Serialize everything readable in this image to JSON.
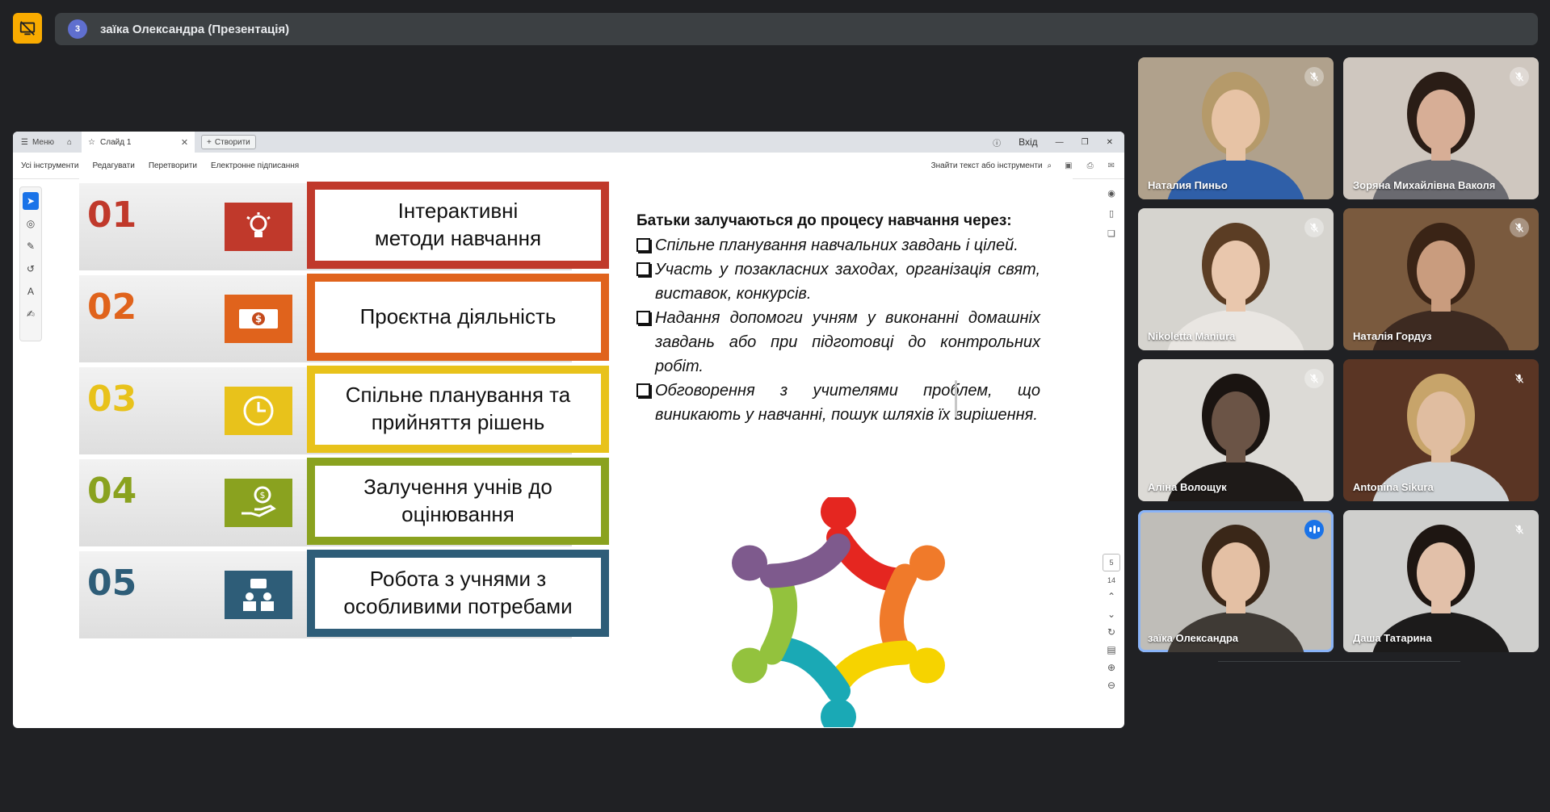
{
  "meeting": {
    "participant_count": "3",
    "title": "заїка Олександра (Презентація)"
  },
  "viewer": {
    "menu_label": "Меню",
    "tab_label": "Слайд 1",
    "new_tab_label": "Створити",
    "login_label": "Вхід",
    "menu_items": [
      "Усі інструменти",
      "Редагувати",
      "Перетворити",
      "Електронне підписання"
    ],
    "search_label": "Знайти текст або інструменти",
    "page_current": "5",
    "page_total": "14"
  },
  "slide": {
    "steps": [
      {
        "num": "01",
        "text": "Інтерактивні\nметоди навчання",
        "color": "#c0392b",
        "icon": "lightbulb-icon"
      },
      {
        "num": "02",
        "text": "Проєктна діяльність",
        "color": "#e0631c",
        "icon": "money-icon"
      },
      {
        "num": "03",
        "text": "Спільне планування та\nприйняття рішень",
        "color": "#e8c21b",
        "icon": "clock-icon"
      },
      {
        "num": "04",
        "text": "Залучення учнів до\nоцінювання",
        "color": "#8aa21f",
        "icon": "hand-coin-icon"
      },
      {
        "num": "05",
        "text": "Робота з учнями з\nособливими потребами",
        "color": "#2e5d78",
        "icon": "group-icon"
      }
    ],
    "heading": "Батьки залучаються до процесу навчання через:",
    "bullets": [
      "Спільне планування навчальних завдань і цілей.",
      "Участь у позакласних заходах, організація свят, виставок, конкурсів.",
      "Надання допомоги учням у виконанні домашніх завдань або при підготовці до контрольних робіт.",
      "Обговорення з учителями проблем, що виникають у навчанні, пошук шляхів їх вирішення."
    ],
    "teamwork_colors": [
      "#e52620",
      "#f07a2a",
      "#f6d300",
      "#1aa9b5",
      "#93c23d",
      "#7e5a8d"
    ]
  },
  "participants": [
    {
      "name": "Наталия Пиньо",
      "bg": "#b0a18c",
      "shirt": "#2f5fa8",
      "hair": "#b59a6a",
      "skin": "#e7c3a5",
      "muted": true,
      "speaking": false
    },
    {
      "name": "Зоряна Михайлівна Ваколя",
      "bg": "#cfc7bf",
      "shirt": "#6a6a70",
      "hair": "#2a1d16",
      "skin": "#d7ae96",
      "muted": true,
      "speaking": false
    },
    {
      "name": "Nikoletta Maniura",
      "bg": "#d6d4cf",
      "shirt": "#e9e6e2",
      "hair": "#5b3d24",
      "skin": "#e9c7ad",
      "muted": true,
      "speaking": false
    },
    {
      "name": "Наталія Гордуз",
      "bg": "#7a5a3e",
      "shirt": "#3d2a21",
      "hair": "#3a2416",
      "skin": "#c99c7e",
      "muted": true,
      "speaking": false
    },
    {
      "name": "Аліна Волощук",
      "bg": "#dcdad6",
      "shirt": "#1e1a18",
      "hair": "#1a1411",
      "skin": "#6b5446",
      "muted": true,
      "speaking": false
    },
    {
      "name": "Antonina Sikura",
      "bg": "#5a3524",
      "shirt": "#cfd3d6",
      "hair": "#c7a46a",
      "skin": "#e0bda0",
      "muted": true,
      "speaking": false,
      "plain_mic": true
    },
    {
      "name": "заїка Олександра",
      "bg": "#bfbdb8",
      "shirt": "#3f3a35",
      "hair": "#3a2718",
      "skin": "#e4c0a4",
      "muted": false,
      "speaking": true
    },
    {
      "name": "Даша Татарина",
      "bg": "#cfcfcd",
      "shirt": "#1c1b1b",
      "hair": "#1e1612",
      "skin": "#e2c0a9",
      "muted": true,
      "speaking": false,
      "plain_mic": true
    }
  ]
}
